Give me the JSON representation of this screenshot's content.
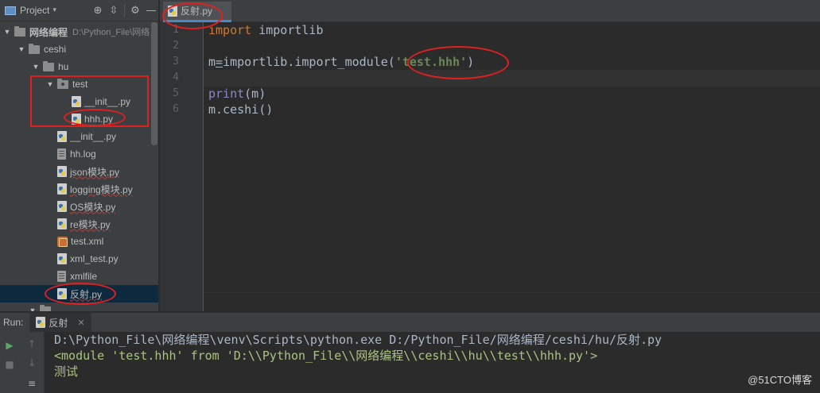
{
  "project_panel": {
    "title": "Project",
    "tree": [
      {
        "label": "网络编程",
        "sub": "D:\\Python_File\\网络",
        "type": "folder",
        "expanded": true,
        "indent": 0
      },
      {
        "label": "ceshi",
        "type": "folder",
        "expanded": true,
        "indent": 1
      },
      {
        "label": "hu",
        "type": "folder",
        "expanded": true,
        "indent": 2
      },
      {
        "label": "test",
        "type": "package",
        "expanded": true,
        "indent": 3
      },
      {
        "label": "__init__.py",
        "type": "py",
        "indent": 4
      },
      {
        "label": "hhh.py",
        "type": "py",
        "indent": 4
      },
      {
        "label": "__init__.py",
        "type": "py",
        "indent": 3
      },
      {
        "label": "hh.log",
        "type": "log",
        "indent": 3
      },
      {
        "label": "json模块.py",
        "type": "py",
        "indent": 3
      },
      {
        "label": "logging模块.py",
        "type": "py",
        "indent": 3
      },
      {
        "label": "OS模块.py",
        "type": "py",
        "indent": 3
      },
      {
        "label": "re模块.py",
        "type": "py",
        "indent": 3
      },
      {
        "label": "test.xml",
        "type": "xml",
        "indent": 3
      },
      {
        "label": "xml_test.py",
        "type": "py",
        "indent": 3
      },
      {
        "label": "xmlfile",
        "type": "log",
        "indent": 3
      },
      {
        "label": "反射.py",
        "type": "py",
        "indent": 3,
        "selected": true
      }
    ]
  },
  "editor": {
    "tab_label": "反射.py",
    "line_numbers": [
      "1",
      "2",
      "3",
      "4",
      "5",
      "6"
    ],
    "code": {
      "l1_kw": "import",
      "l1_rest": " importlib",
      "l3_a": "m",
      "l3_b": "=",
      "l3_c": "importlib.import_module(",
      "l3_str": "'test.hhh'",
      "l3_d": ")",
      "l5_fn": "print",
      "l5_rest": "(m)",
      "l6": "m.ceshi()"
    }
  },
  "run_panel": {
    "label": "Run:",
    "tab_label": "反射",
    "output": [
      "D:\\Python_File\\网络编程\\venv\\Scripts\\python.exe D:/Python_File/网络编程/ceshi/hu/反射.py",
      "<module 'test.hhh' from 'D:\\\\Python_File\\\\网络编程\\\\ceshi\\\\hu\\\\test\\\\hhh.py'>",
      "测试"
    ],
    "watermark": "@51CTO博客"
  },
  "colors": {
    "keyword": "#cc7832",
    "string": "#6a8759",
    "annotation": "#e02020",
    "selection": "#0d293e"
  }
}
